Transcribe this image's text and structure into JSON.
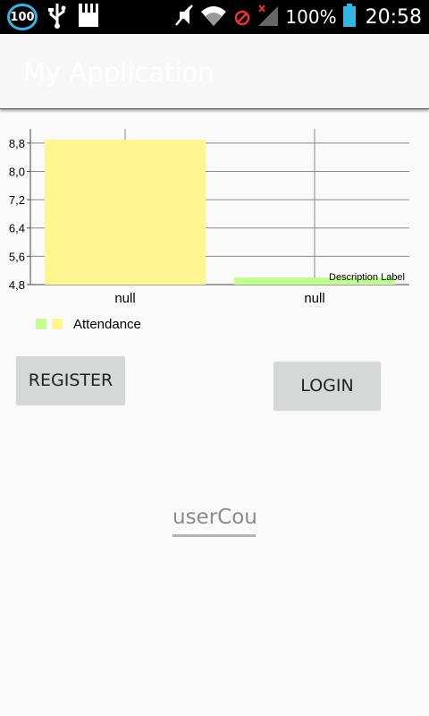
{
  "status_bar": {
    "notification_count": "100",
    "battery": "100%",
    "time": "20:58",
    "accent": "#33b5e5"
  },
  "app_bar": {
    "title": "My Application"
  },
  "chart_data": {
    "type": "bar",
    "categories": [
      "null",
      "null"
    ],
    "series": [
      {
        "name": "Attendance",
        "values": [
          8.9,
          5.0
        ],
        "colors": [
          "#fff68f",
          "#c1ff8f"
        ]
      }
    ],
    "yticks": [
      "4,8",
      "5,6",
      "6,4",
      "7,2",
      "8,0",
      "8,8"
    ],
    "ylim": [
      4.8,
      9.2
    ],
    "description": "Description Label",
    "grid": true,
    "legend": "bottom-left"
  },
  "buttons": {
    "register": "REGISTER",
    "login": "LOGIN"
  },
  "user_field": {
    "text": "userCount"
  }
}
